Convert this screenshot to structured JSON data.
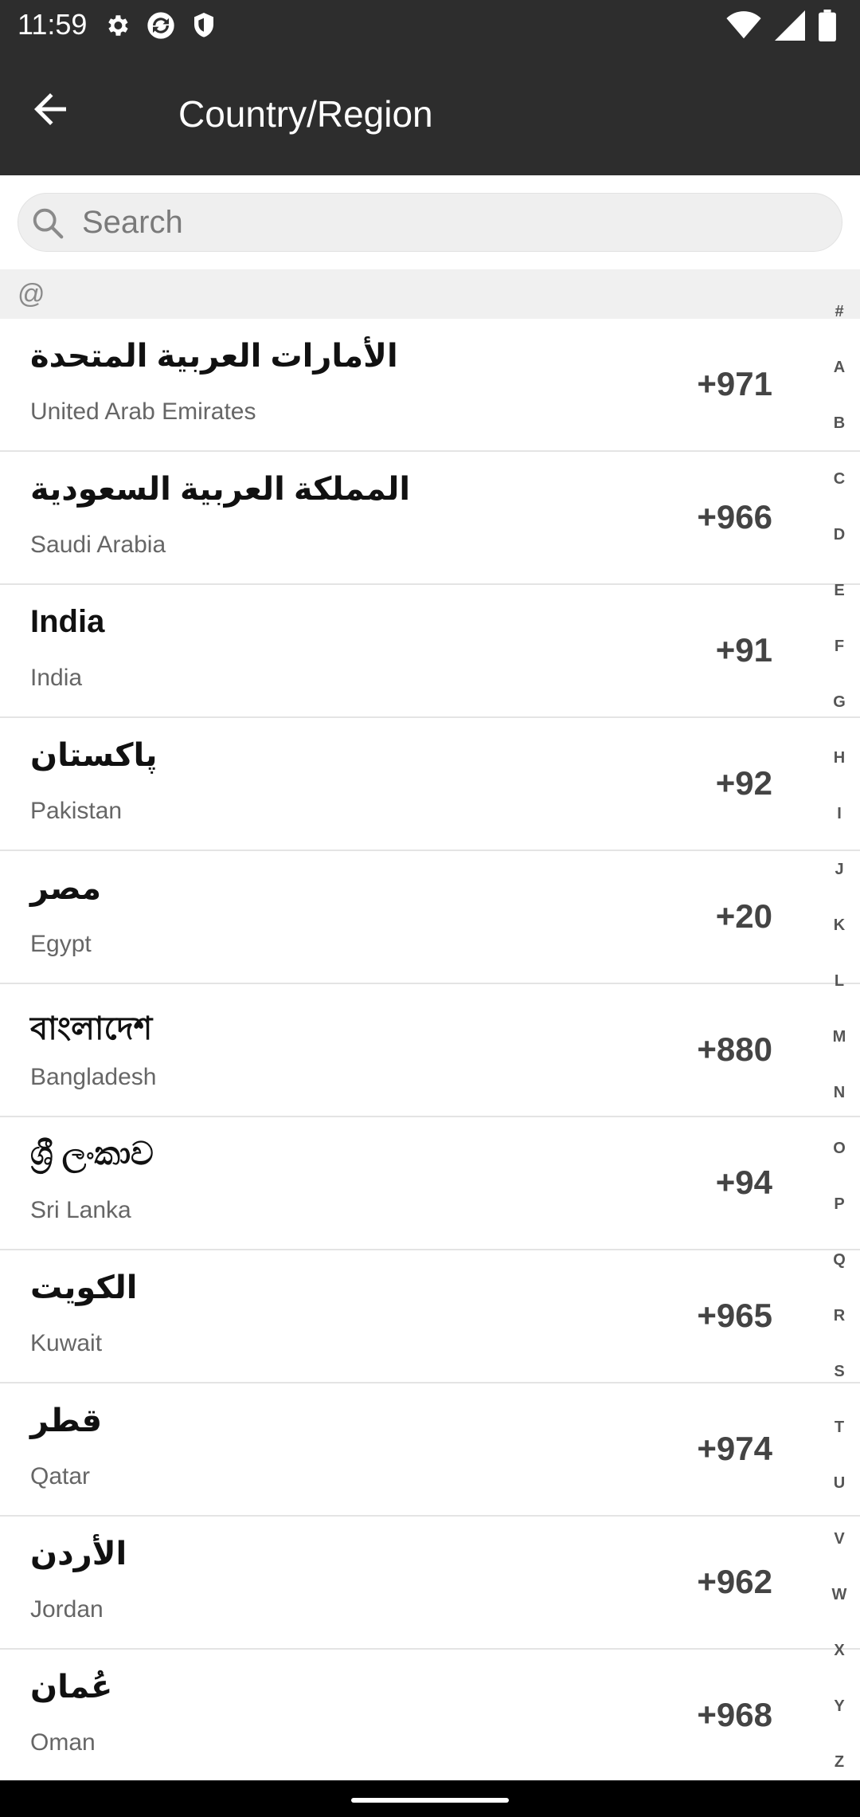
{
  "status_bar": {
    "time": "11:59",
    "left_icons": [
      "gear-icon",
      "sync-icon",
      "shield-icon"
    ],
    "right_icons": [
      "wifi-icon",
      "signal-icon",
      "battery-icon"
    ]
  },
  "app_bar": {
    "title": "Country/Region",
    "back_icon": "arrow-back-icon"
  },
  "search": {
    "placeholder": "Search",
    "icon": "search-icon"
  },
  "section": {
    "label": "@"
  },
  "countries": [
    {
      "native": "الأمارات العربية المتحدة",
      "english": "United Arab Emirates",
      "code": "+971"
    },
    {
      "native": "المملكة العربية السعودية",
      "english": "Saudi Arabia",
      "code": "+966"
    },
    {
      "native": "India",
      "english": "India",
      "code": "+91"
    },
    {
      "native": "پاکستان",
      "english": "Pakistan",
      "code": "+92"
    },
    {
      "native": "مصر",
      "english": "Egypt",
      "code": "+20"
    },
    {
      "native": "বাংলাদেশ",
      "english": "Bangladesh",
      "code": "+880"
    },
    {
      "native": "ශ්‍රී ලංකාව",
      "english": "Sri Lanka",
      "code": "+94"
    },
    {
      "native": "الكويت",
      "english": "Kuwait",
      "code": "+965"
    },
    {
      "native": "قطر",
      "english": "Qatar",
      "code": "+974"
    },
    {
      "native": "الأردن",
      "english": "Jordan",
      "code": "+962"
    },
    {
      "native": "عُمان",
      "english": "Oman",
      "code": "+968"
    }
  ],
  "index_letters": [
    "#",
    "A",
    "B",
    "C",
    "D",
    "E",
    "F",
    "G",
    "H",
    "I",
    "J",
    "K",
    "L",
    "M",
    "N",
    "O",
    "P",
    "Q",
    "R",
    "S",
    "T",
    "U",
    "V",
    "W",
    "X",
    "Y",
    "Z"
  ],
  "colors": {
    "app_bar": "#2d2d2d",
    "section_bg": "#f0f0f0",
    "search_bg": "#efefef"
  }
}
